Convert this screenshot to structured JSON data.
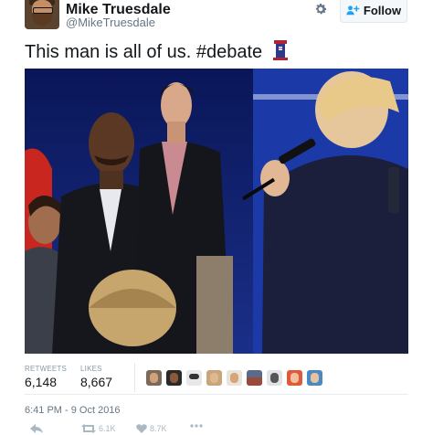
{
  "header": {
    "display_name": "Mike Truesdale",
    "handle": "@MikeTruesdale",
    "follow_label": "Follow"
  },
  "tweet": {
    "text": "This man is all of us. #debate"
  },
  "stats": {
    "retweets_label": "RETWEETS",
    "retweets_count": "6,148",
    "likes_label": "LIKES",
    "likes_count": "8,667"
  },
  "timestamp": "6:41 PM - 9 Oct 2016",
  "actions": {
    "retweet_count": "6.1K",
    "like_count": "8.7K"
  },
  "icons": [
    "settings-gear-icon",
    "follow-person-plus-icon",
    "debate-podium-emoji",
    "reply-arrow-icon",
    "retweet-icon",
    "heart-icon",
    "more-dots-icon"
  ],
  "colors": {
    "accent": "#1da1f2",
    "secondary_text": "#657786",
    "muted": "#aab8c2"
  }
}
